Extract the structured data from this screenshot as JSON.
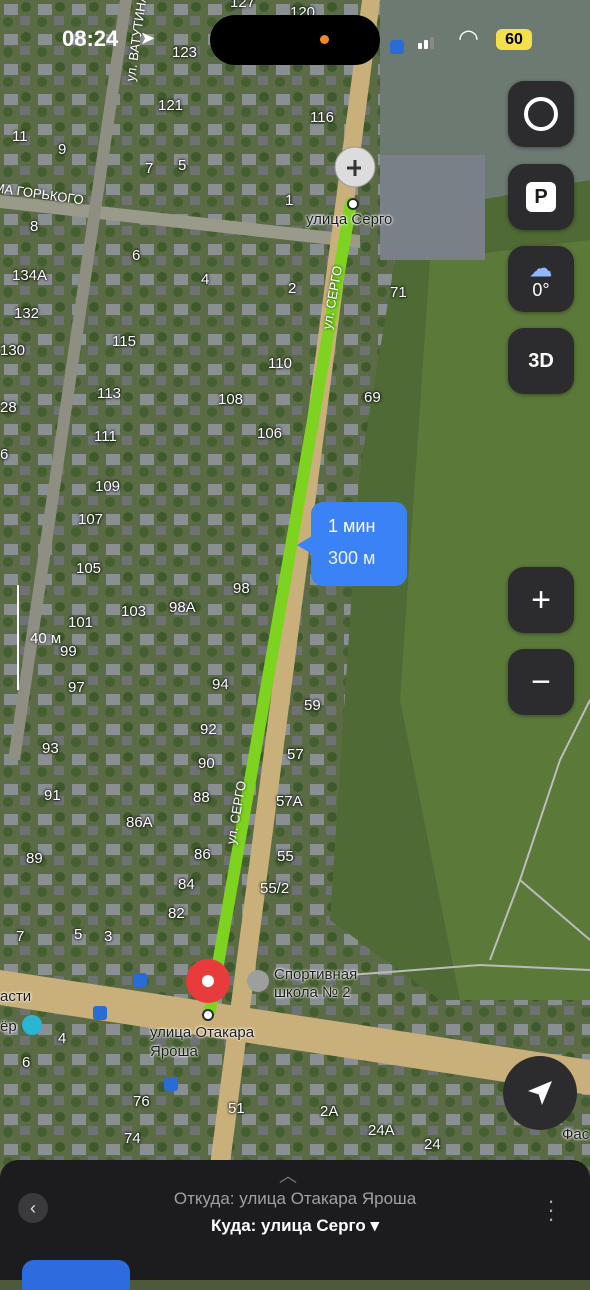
{
  "status": {
    "time": "08:24",
    "battery": "60"
  },
  "map": {
    "house_numbers": [
      "120",
      "123",
      "121",
      "116",
      "11",
      "9",
      "7",
      "5",
      "1",
      "8",
      "6",
      "4",
      "2",
      "71",
      "134А",
      "132",
      "130",
      "115",
      "110",
      "28",
      "113",
      "108",
      "69",
      "111",
      "106",
      "6",
      "109",
      "107",
      "105",
      "98",
      "103",
      "98А",
      "101",
      "99",
      "97",
      "94",
      "59",
      "92",
      "93",
      "90",
      "57",
      "91",
      "88",
      "57А",
      "86А",
      "89",
      "86",
      "55",
      "84",
      "55/2",
      "82",
      "7",
      "5",
      "3",
      "4",
      "6",
      "76",
      "74",
      "51",
      "2А",
      "24А",
      "24",
      "127"
    ],
    "streets": [
      "улица Серго",
      "ул. СЕРГО",
      "ул. СЕРГО",
      "МАКСИМА ГОРЬКОГО",
      "ул. ВАТУТИНА",
      "улица Отакара Ярошa",
      "Спортивная школа № 2",
      "асти",
      "ёр",
      "Фас"
    ],
    "scale": "40 м",
    "colors": {
      "route": "#7ed321",
      "bubble": "#3b82f6"
    }
  },
  "route": {
    "time": "1 мин",
    "distance": "300 м"
  },
  "buttons": {
    "parking": "P",
    "weather": "0°",
    "three_d": "3D",
    "zoom_in": "+",
    "zoom_out": "−"
  },
  "panel": {
    "from": "Откуда: улица Отакара Яроша",
    "to": "Куда: улица Серго ▾"
  }
}
